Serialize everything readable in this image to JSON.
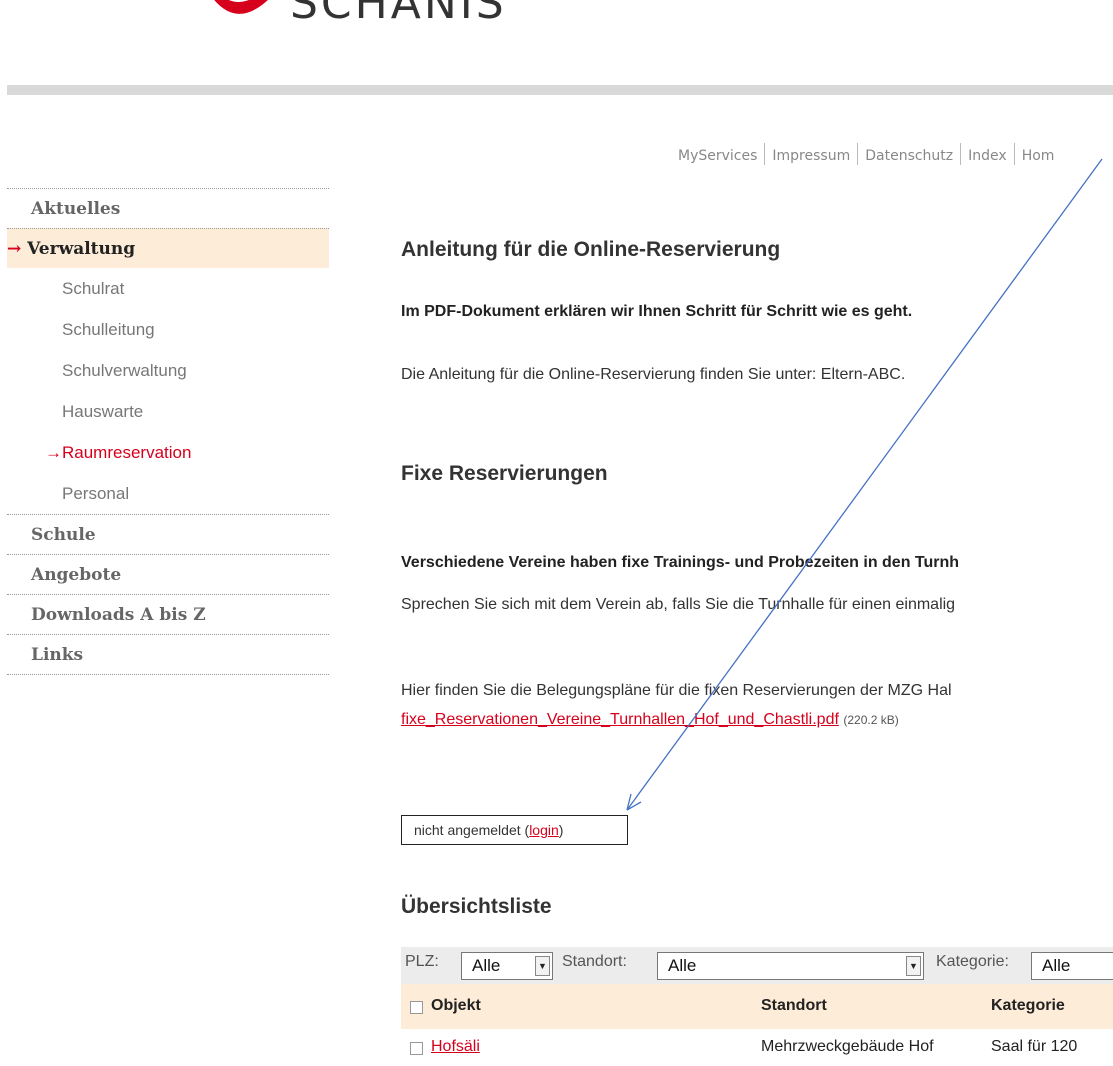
{
  "brand": {
    "logo_text": "SCHANIS"
  },
  "service_links": [
    "MyServices",
    "Impressum",
    "Datenschutz",
    "Index",
    "Hom"
  ],
  "sidenav": {
    "items": [
      {
        "label": "Aktuelles"
      },
      {
        "label": "Verwaltung",
        "arrow": "→"
      },
      {
        "label": "Schule"
      },
      {
        "label": "Angebote"
      },
      {
        "label": "Downloads A bis Z"
      },
      {
        "label": "Links"
      }
    ],
    "subitems": [
      {
        "label": "Schulrat"
      },
      {
        "label": "Schulleitung"
      },
      {
        "label": "Schulverwaltung"
      },
      {
        "label": "Hauswarte"
      },
      {
        "label": "Raumreservation",
        "arrow": "→"
      },
      {
        "label": "Personal"
      }
    ]
  },
  "content": {
    "title": "Anleitung für die Online-Reservierung",
    "intro_bold": "Im PDF-Dokument erklären wir Ihnen Schritt für Schritt wie es geht.",
    "intro_text": "Die Anleitung für die Online-Reservierung finden Sie unter: Eltern-ABC.",
    "section_title": "Fixe Reservierungen",
    "section_bold": "Verschiedene Vereine haben fixe Trainings- und Probezeiten in den Turnh",
    "section_text": "Sprechen Sie sich mit dem Verein ab, falls Sie die Turnhalle für einen einmalig",
    "plans_text": "Hier finden Sie die Belegungspläne für die fixen Reservierungen der MZG Hal",
    "pdf_link": "fixe_Reservationen_Vereine_Turnhallen_Hof_und_Chastli.pdf",
    "pdf_size": "(220.2 kB)"
  },
  "login": {
    "prefix": "nicht angemeldet (",
    "link": "login",
    "suffix": ")"
  },
  "overview": {
    "title": "Übersichtsliste",
    "filters": {
      "plz_label": "PLZ:",
      "plz_value": "Alle",
      "standort_label": "Standort:",
      "standort_value": "Alle",
      "kategorie_label": "Kategorie:",
      "kategorie_value": "Alle",
      "dropdown_icon": "▼"
    },
    "columns": [
      "Objekt",
      "Standort",
      "Kategorie"
    ],
    "rows": [
      {
        "objekt": "Hofsäli",
        "standort": "Mehrzweckgebäude Hof",
        "kategorie": "Saal für 120"
      }
    ]
  },
  "colors": {
    "accent": "#d6001c",
    "highlight": "#fcecd8",
    "annotation_arrow": "#4472c4"
  }
}
